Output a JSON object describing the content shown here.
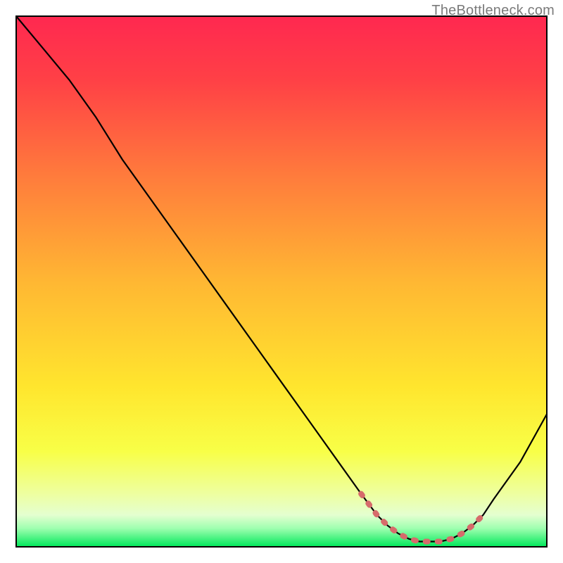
{
  "watermark": "TheBottleneck.com",
  "chart_data": {
    "type": "line",
    "title": "",
    "xlabel": "",
    "ylabel": "",
    "xlim": [
      0,
      100
    ],
    "ylim": [
      0,
      100
    ],
    "x": [
      0,
      5,
      10,
      15,
      20,
      25,
      30,
      35,
      40,
      45,
      50,
      55,
      60,
      65,
      68,
      70,
      72,
      74,
      76,
      78,
      80,
      82,
      84,
      86,
      88,
      90,
      95,
      100
    ],
    "y": [
      100,
      94,
      88,
      81,
      73,
      66,
      59,
      52,
      45,
      38,
      31,
      24,
      17,
      10,
      6,
      4,
      2.5,
      1.5,
      1,
      1,
      1,
      1.5,
      2.5,
      4,
      6,
      9,
      16,
      25
    ],
    "notes": "Values are approximate readings from the un-labeled axes; they represent a bottleneck curve descending from top-left, reaching a broad minimum around x=74–82, then rising again toward the right edge.",
    "highlight_segment": {
      "x_start": 65,
      "x_end": 88
    },
    "background_gradient": {
      "stops": [
        {
          "offset": 0.0,
          "color": "#ff2850"
        },
        {
          "offset": 0.12,
          "color": "#ff4046"
        },
        {
          "offset": 0.3,
          "color": "#ff7b3c"
        },
        {
          "offset": 0.5,
          "color": "#ffb733"
        },
        {
          "offset": 0.7,
          "color": "#ffe62e"
        },
        {
          "offset": 0.82,
          "color": "#f8ff47"
        },
        {
          "offset": 0.9,
          "color": "#eeffa0"
        },
        {
          "offset": 0.94,
          "color": "#e4ffd0"
        },
        {
          "offset": 0.965,
          "color": "#9fffb0"
        },
        {
          "offset": 1.0,
          "color": "#00e85a"
        }
      ]
    }
  }
}
